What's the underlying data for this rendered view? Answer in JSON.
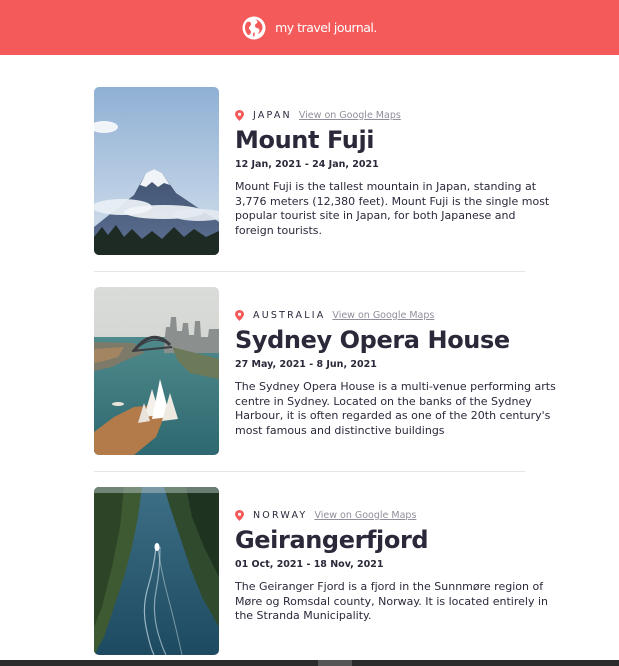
{
  "header": {
    "title": "my travel journal.",
    "bg": "#f55a5a"
  },
  "entries": [
    {
      "country": "JAPAN",
      "maps_link": "View on Google Maps",
      "title": "Mount Fuji",
      "dates": "12 Jan, 2021 - 24 Jan, 2021",
      "description": "Mount Fuji is the tallest mountain in Japan, standing at 3,776 meters (12,380 feet). Mount Fuji is the single most popular tourist site in Japan, for both Japanese and foreign tourists."
    },
    {
      "country": "AUSTRALIA",
      "maps_link": "View on Google Maps",
      "title": "Sydney Opera House",
      "dates": "27 May, 2021 - 8 Jun, 2021",
      "description": "The Sydney Opera House is a multi-venue performing arts centre in Sydney. Located on the banks of the Sydney Harbour, it is often regarded as one of the 20th century's most famous and distinctive buildings"
    },
    {
      "country": "NORWAY",
      "maps_link": "View on Google Maps",
      "title": "Geirangerfjord",
      "dates": "01 Oct, 2021 - 18 Nov, 2021",
      "description": "The Geiranger Fjord is a fjord in the Sunnmøre region of Møre og Romsdal county, Norway. It is located entirely in the Stranda Municipality."
    }
  ],
  "icons": {
    "brand": "globe-icon",
    "location": "map-pin-icon"
  },
  "colors": {
    "accent": "#f55a5a",
    "text": "#2b283a",
    "link": "#918e9b"
  }
}
